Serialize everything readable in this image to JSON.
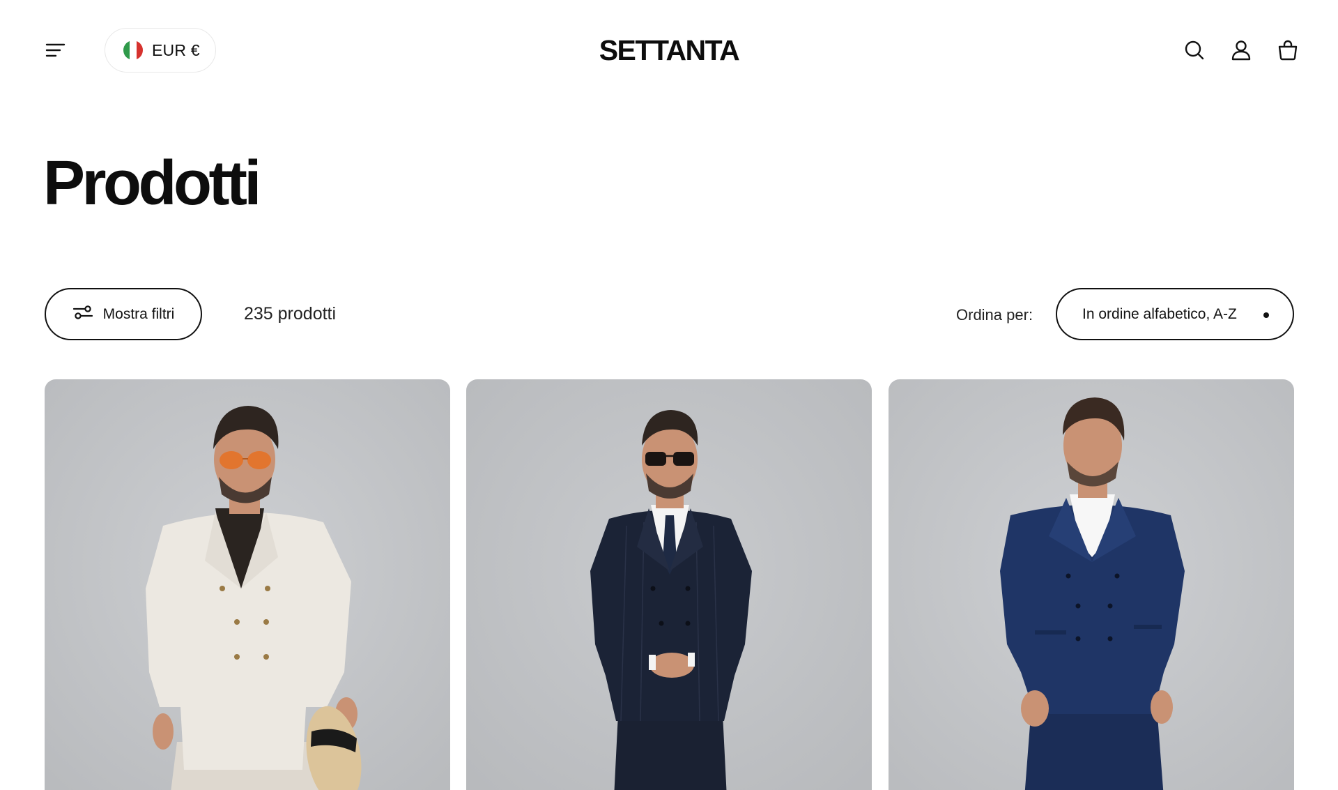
{
  "header": {
    "menu_icon": "hamburger-menu-icon",
    "currency": {
      "label": "EUR €",
      "flag_colors": [
        "#2f9a4a",
        "#ffffff",
        "#d6322e"
      ]
    },
    "logo": "SETTANTA",
    "icons": [
      "search-icon",
      "account-icon",
      "shopping-bag-icon"
    ]
  },
  "page": {
    "title": "Prodotti"
  },
  "toolbar": {
    "filter_button": "Mostra filtri",
    "filter_icon": "sliders-icon",
    "product_count": "235 prodotti",
    "sort_label": "Ordina per:",
    "sort_value": "In ordine alfabetico, A-Z"
  },
  "products": [
    {
      "image": "model-cream-double-breasted-suit-with-hat",
      "suit_color": "#efebe4",
      "shirt_color": "#2a2420"
    },
    {
      "image": "model-navy-pinstripe-double-breasted-suit",
      "suit_color": "#1b2336",
      "shirt_color": "#f4f4f4"
    },
    {
      "image": "model-blue-double-breasted-suit",
      "suit_color": "#1f3566",
      "shirt_color": "#f7f7f7"
    }
  ],
  "colors": {
    "text": "#111111",
    "background": "#ffffff",
    "photo_background": "#c6c8cb"
  }
}
